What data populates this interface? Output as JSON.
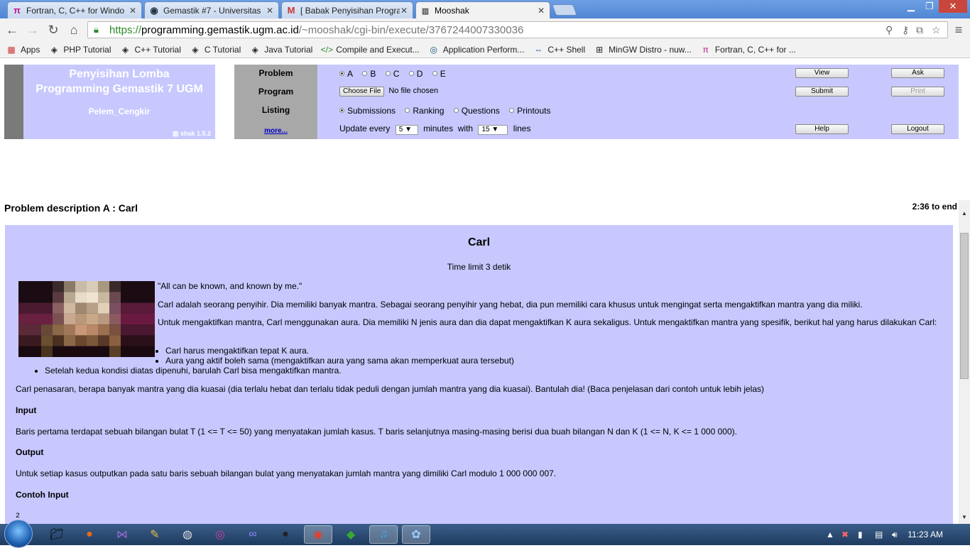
{
  "browser": {
    "tabs": [
      {
        "title": "Fortran, C, C++ for Windo",
        "icon": "pi-icon"
      },
      {
        "title": "Gemastik #7 - Universitas",
        "icon": "globe-icon"
      },
      {
        "title": "[ Babak Penyisihan Progra",
        "icon": "gmail-icon"
      },
      {
        "title": "Mooshak",
        "icon": "mooshak-icon"
      }
    ],
    "url_proto": "https://",
    "url_host": "programming.gemastik.ugm.ac.id",
    "url_path": "/~mooshak/cgi-bin/execute/3767244007330036",
    "bookmarks": [
      {
        "label": "Apps",
        "icon": "apps-grid-icon"
      },
      {
        "label": "PHP Tutorial",
        "icon": "diamond-icon"
      },
      {
        "label": "C++ Tutorial",
        "icon": "diamond-icon"
      },
      {
        "label": "C Tutorial",
        "icon": "diamond-icon"
      },
      {
        "label": "Java Tutorial",
        "icon": "diamond-icon"
      },
      {
        "label": "Compile and Execut...",
        "icon": "code-icon"
      },
      {
        "label": "Application Perform...",
        "icon": "circle-icon"
      },
      {
        "label": "C++ Shell",
        "icon": "arrows-icon"
      },
      {
        "label": "MinGW Distro - nuw...",
        "icon": "grid-icon"
      },
      {
        "label": "Fortran, C, C++ for ...",
        "icon": "pi-icon"
      }
    ]
  },
  "logo": {
    "title_line1": "Penyisihan Lomba",
    "title_line2": "Programming Gemastik 7 UGM",
    "team": "Pelem_Cengkir",
    "version": "shak 1.5.2"
  },
  "controls": {
    "problem_label": "Problem",
    "program_label": "Program",
    "listing_label": "Listing",
    "more_link": "more...",
    "problems": [
      "A",
      "B",
      "C",
      "D",
      "E"
    ],
    "selected_problem": "A",
    "choose_file": "Choose File",
    "no_file": "No file chosen",
    "listing_options": [
      "Submissions",
      "Ranking",
      "Questions",
      "Printouts"
    ],
    "selected_listing": "Submissions",
    "update_every": "Update every",
    "update_value": "5",
    "minutes_with": "minutes  with",
    "lines_value": "15",
    "lines": "lines",
    "buttons": {
      "view": "View",
      "ask": "Ask",
      "submit": "Submit",
      "print": "Print",
      "help": "Help",
      "logout": "Logout"
    }
  },
  "problem": {
    "header": "Problem description A : Carl",
    "time_left": "2:36 to end",
    "title": "Carl",
    "time_limit": "Time limit 3 detik",
    "quote": "\"All can be known, and known by me.\"",
    "para1": "Carl adalah seorang penyihir. Dia memiliki banyak mantra. Sebagai seorang penyihir yang hebat, dia pun memiliki cara khusus untuk mengingat serta mengaktifkan mantra yang dia miliki.",
    "para2": "Untuk mengaktifkan mantra, Carl menggunakan aura. Dia memiliki N jenis aura dan dia dapat mengaktifkan K aura sekaligus. Untuk mengaktifkan mantra yang spesifik, berikut hal yang harus dilakukan Carl:",
    "bullet1": "Carl harus mengaktifkan tepat K aura.",
    "bullet2": "Aura yang aktif boleh sama (mengaktifkan aura yang sama akan memperkuat aura tersebut)",
    "bullet3": "Setelah kedua kondisi diatas dipenuhi, barulah Carl bisa mengaktifkan mantra.",
    "para3": "Carl penasaran, berapa banyak mantra yang dia kuasai (dia terlalu hebat dan terlalu tidak peduli dengan jumlah mantra yang dia kuasai). Bantulah dia! (Baca penjelasan dari contoh untuk lebih jelas)",
    "input_h": "Input",
    "input_text": "Baris pertama terdapat sebuah bilangan bulat T (1 <= T <= 50) yang menyatakan jumlah kasus. T baris selanjutnya masing-masing berisi dua buah bilangan N dan K (1 <= N, K <= 1 000 000).",
    "output_h": "Output",
    "output_text": "Untuk setiap kasus outputkan pada satu baris sebuah bilangan bulat yang menyatakan jumlah mantra yang dimiliki Carl modulo 1 000 000 007.",
    "sample_h": "Contoh Input",
    "sample_first": "2"
  },
  "taskbar": {
    "clock": "11:23 AM"
  }
}
